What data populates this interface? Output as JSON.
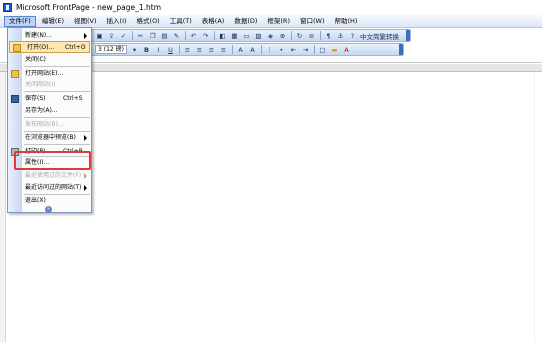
{
  "window": {
    "title": "Microsoft FrontPage - new_page_1.htm"
  },
  "menubar": {
    "items": [
      "文件(F)",
      "编辑(E)",
      "视图(V)",
      "插入(I)",
      "格式(O)",
      "工具(T)",
      "表格(A)",
      "数据(D)",
      "框架(R)",
      "窗口(W)",
      "帮助(H)"
    ],
    "active_index": 0
  },
  "toolbar_standard": {
    "ime_label": "中文简繁转换"
  },
  "toolbar_format": {
    "font_size": "3 (12 磅)",
    "bold_label": "B",
    "italic_label": "I",
    "underline_label": "U"
  },
  "file_menu": {
    "items": [
      {
        "label": "新建(N)...",
        "shortcut": "",
        "disabled": false,
        "submenu": false
      },
      {
        "label": "打开(O)...",
        "shortcut": "Ctrl+O",
        "disabled": false,
        "submenu": false,
        "highlighted": true
      },
      {
        "label": "关闭(C)",
        "shortcut": "",
        "disabled": false,
        "submenu": false
      },
      {
        "label": "打开网站(E)...",
        "shortcut": "",
        "disabled": false,
        "submenu": false
      },
      {
        "label": "关闭网站(I)",
        "shortcut": "",
        "disabled": true,
        "submenu": false
      },
      {
        "label": "保存(S)",
        "shortcut": "Ctrl+S",
        "disabled": false,
        "submenu": false
      },
      {
        "label": "另存为(A)...",
        "shortcut": "",
        "disabled": false,
        "submenu": false
      },
      {
        "label": "发布网站(B)...",
        "shortcut": "",
        "disabled": true,
        "submenu": false
      },
      {
        "label": "在浏览器中预览(B)",
        "shortcut": "",
        "disabled": false,
        "submenu": true
      },
      {
        "label": "打印(P)...",
        "shortcut": "Ctrl+P",
        "disabled": false,
        "submenu": false
      },
      {
        "label": "属性(I)...",
        "shortcut": "",
        "disabled": false,
        "submenu": false
      },
      {
        "label": "最近使用过的文件(F)",
        "shortcut": "",
        "disabled": true,
        "submenu": true
      },
      {
        "label": "最近访问过的网站(T)",
        "shortcut": "",
        "disabled": false,
        "submenu": true
      },
      {
        "label": "退出(X)",
        "shortcut": "",
        "disabled": false,
        "submenu": false
      }
    ],
    "expand_glyph": "»"
  }
}
